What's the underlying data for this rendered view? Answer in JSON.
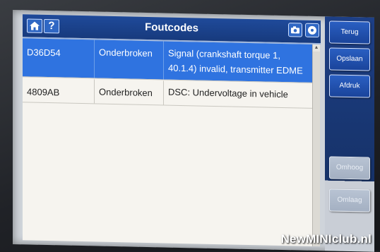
{
  "header": {
    "title": "Foutcodes",
    "home_icon": "home-icon",
    "help_glyph": "?",
    "camera_icon": "camera-icon",
    "disc_icon": "disc-icon"
  },
  "table": {
    "rows": [
      {
        "code": "D36D54",
        "status": "Onderbroken",
        "description_line1": "Signal (crankshaft torque 1,",
        "description_line2": "40.1.4) invalid, transmitter EDME",
        "selected": true
      },
      {
        "code": "4809AB",
        "status": "Onderbroken",
        "description_line1": "DSC: Undervoltage in vehicle",
        "description_line2": "",
        "selected": false
      }
    ]
  },
  "sidebar": {
    "back_label": "Terug",
    "save_label": "Opslaan",
    "print_label": "Afdruk",
    "page_up_label": "Omhoog",
    "page_down_label": "Omlaag"
  },
  "watermark": "NewMINIclub.nl",
  "colors": {
    "accent": "#2f73e0",
    "titlebar": "#1f4a9a"
  }
}
